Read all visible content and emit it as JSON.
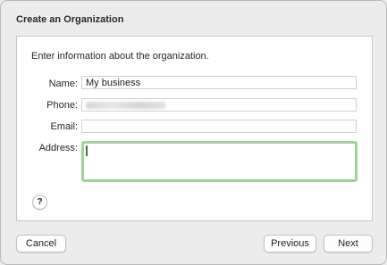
{
  "dialog": {
    "title": "Create an Organization",
    "intro": "Enter information about the organization."
  },
  "form": {
    "name_label": "Name:",
    "name_value": "My business",
    "phone_label": "Phone:",
    "email_label": "Email:",
    "address_label": "Address:",
    "address_value": ""
  },
  "buttons": {
    "help": "?",
    "cancel": "Cancel",
    "previous": "Previous",
    "next": "Next"
  },
  "colors": {
    "focus_ring": "#9ed29a"
  }
}
